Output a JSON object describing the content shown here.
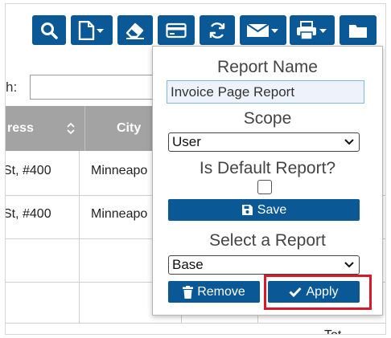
{
  "toolbar": {
    "icons": [
      "search-icon",
      "new-file-dropdown-icon",
      "eraser-icon",
      "card-icon",
      "refresh-icon",
      "email-dropdown-icon",
      "print-dropdown-icon",
      "folder-icon"
    ],
    "color": "#0a5895"
  },
  "search": {
    "label": "h:",
    "value": ""
  },
  "table": {
    "headers": [
      "ress",
      "City"
    ],
    "rows": [
      {
        "address": "St, #400",
        "city": "Minneapo"
      },
      {
        "address": "St, #400",
        "city": "Minneapo"
      },
      {
        "address": "",
        "city": ""
      },
      {
        "address": "",
        "city": ""
      }
    ],
    "header_color": "#a3a3a3",
    "footer_partial": "Tot"
  },
  "report_popup": {
    "report_name_label": "Report Name",
    "report_name_value": "Invoice Page Report",
    "scope_label": "Scope",
    "scope_value": "User",
    "is_default_label": "Is Default Report?",
    "is_default_checked": false,
    "save_label": "Save",
    "select_report_label": "Select a Report",
    "selected_report": "Base",
    "remove_label": "Remove",
    "apply_label": "Apply",
    "highlight_color": "#d6192b"
  }
}
